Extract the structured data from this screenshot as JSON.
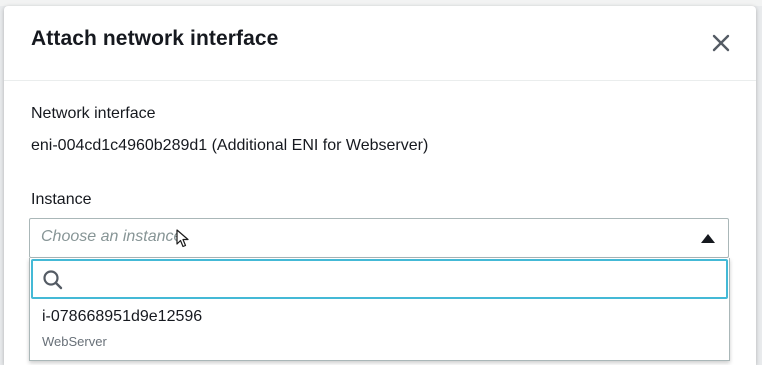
{
  "modal": {
    "title": "Attach network interface"
  },
  "network_interface": {
    "label": "Network interface",
    "value": "eni-004cd1c4960b289d1 (Additional ENI for Webserver)"
  },
  "instance": {
    "label": "Instance",
    "placeholder": "Choose an instance",
    "search_value": "",
    "options": [
      {
        "id": "i-078668951d9e12596",
        "tag": "WebServer"
      }
    ]
  },
  "colors": {
    "focus_border": "#44b9d6",
    "text": "#16191f",
    "placeholder": "#879596"
  }
}
